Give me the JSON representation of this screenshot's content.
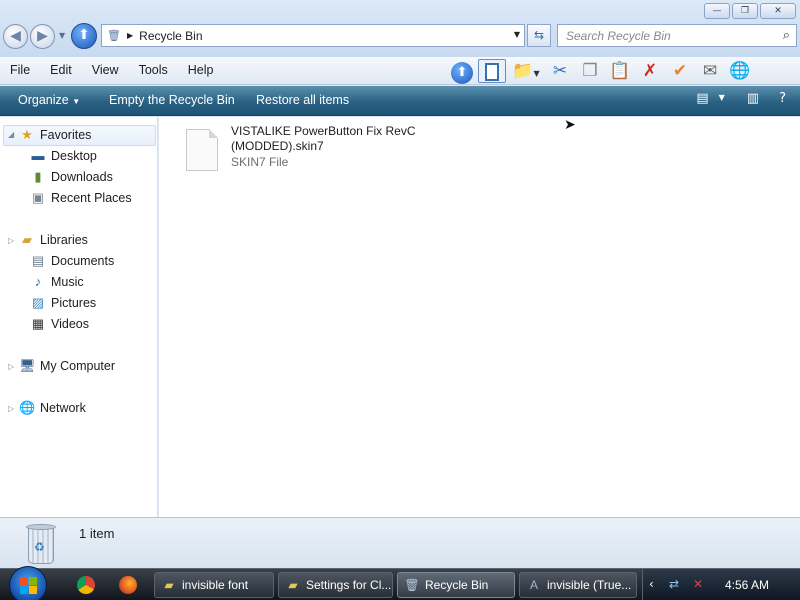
{
  "window": {
    "controls": [
      "minimize",
      "maximize",
      "close"
    ]
  },
  "address_bar": {
    "path": "Recycle Bin",
    "icon": "recycle-bin-icon"
  },
  "search": {
    "placeholder": "Search Recycle Bin"
  },
  "menu": {
    "items": [
      "File",
      "Edit",
      "View",
      "Tools",
      "Help"
    ]
  },
  "toolbar_icons": [
    "up-folder-icon",
    "pane-toggle-icon",
    "folder-options-icon",
    "cut-icon",
    "copy-icon",
    "paste-icon",
    "delete-icon",
    "checkmark-icon",
    "email-icon",
    "globe-icon"
  ],
  "command_bar": {
    "organize": "Organize",
    "empty": "Empty the Recycle Bin",
    "restore": "Restore all items"
  },
  "nav": {
    "favorites": "Favorites",
    "desktop": "Desktop",
    "downloads": "Downloads",
    "recent": "Recent Places",
    "libraries": "Libraries",
    "documents": "Documents",
    "music": "Music",
    "pictures": "Pictures",
    "videos": "Videos",
    "computer": "My Computer",
    "network": "Network"
  },
  "content": {
    "files": [
      {
        "name": "VISTALIKE PowerButton Fix RevC (MODDED).skin7",
        "type": "SKIN7 File"
      }
    ]
  },
  "details": {
    "count": "1 item"
  },
  "taskbar": {
    "buttons": [
      {
        "label": "invisible font",
        "icon": "folder-icon"
      },
      {
        "label": "Settings for Cl...",
        "icon": "folder-icon"
      },
      {
        "label": "Recycle Bin",
        "icon": "recycle-bin-icon"
      },
      {
        "label": "invisible (True...",
        "icon": "font-icon"
      }
    ],
    "clock": "4:56 AM"
  },
  "colors": {
    "command_bar": "#2b6283",
    "taskbar": "#1a2028",
    "accent": "#1d55b6"
  }
}
